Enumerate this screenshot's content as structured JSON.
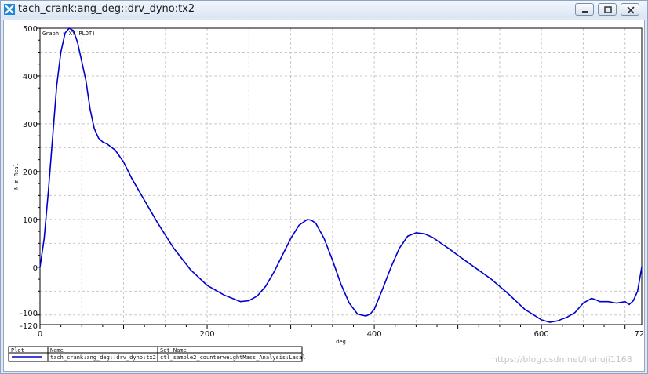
{
  "window": {
    "title": "tach_crank:ang_deg::drv_dyno:tx2",
    "controls": [
      "minimize",
      "maximize",
      "close"
    ]
  },
  "chart_data": {
    "type": "line",
    "title": "Graph ( XY PLOT)",
    "xlabel": "deg",
    "ylabel": "N-m Real",
    "xlim": [
      0,
      720
    ],
    "ylim": [
      -120,
      500
    ],
    "xticks": [
      0,
      200,
      400,
      600,
      720
    ],
    "yticks": [
      500,
      400,
      300,
      200,
      100,
      0,
      -100,
      -120
    ],
    "grid": true,
    "series": [
      {
        "name": "tach_crank:ang_deg::drv_dyno:tx2",
        "color": "#0000cc",
        "x": [
          0,
          5,
          10,
          15,
          20,
          25,
          30,
          35,
          40,
          45,
          50,
          55,
          60,
          65,
          70,
          75,
          80,
          90,
          100,
          110,
          120,
          140,
          160,
          180,
          200,
          220,
          240,
          250,
          260,
          270,
          280,
          290,
          300,
          310,
          320,
          325,
          330,
          340,
          350,
          360,
          370,
          380,
          390,
          395,
          400,
          410,
          420,
          430,
          440,
          450,
          460,
          470,
          480,
          490,
          500,
          520,
          540,
          560,
          580,
          600,
          610,
          620,
          625,
          630,
          640,
          650,
          660,
          665,
          670,
          680,
          690,
          700,
          705,
          710,
          715,
          720
        ],
        "y": [
          0,
          60,
          160,
          270,
          380,
          450,
          490,
          500,
          495,
          470,
          430,
          390,
          330,
          290,
          270,
          262,
          258,
          245,
          220,
          185,
          155,
          95,
          40,
          -5,
          -38,
          -58,
          -72,
          -70,
          -60,
          -40,
          -10,
          25,
          60,
          88,
          100,
          98,
          92,
          60,
          15,
          -35,
          -75,
          -98,
          -102,
          -98,
          -88,
          -45,
          0,
          40,
          65,
          72,
          70,
          62,
          50,
          38,
          25,
          0,
          -25,
          -55,
          -88,
          -110,
          -115,
          -112,
          -108,
          -105,
          -95,
          -75,
          -65,
          -68,
          -72,
          -72,
          -75,
          -72,
          -78,
          -70,
          -50,
          0
        ]
      }
    ],
    "legend": {
      "headers": [
        "Plot",
        "Name",
        "Set Name"
      ],
      "rows": [
        {
          "name": "tach_crank:ang_deg::drv_dyno:tx2",
          "set_name": "ctl_sample2_counterweightMass_Analysis:Lasal"
        }
      ]
    }
  },
  "watermark": "https://blog.csdn.net/liuhuji1168"
}
